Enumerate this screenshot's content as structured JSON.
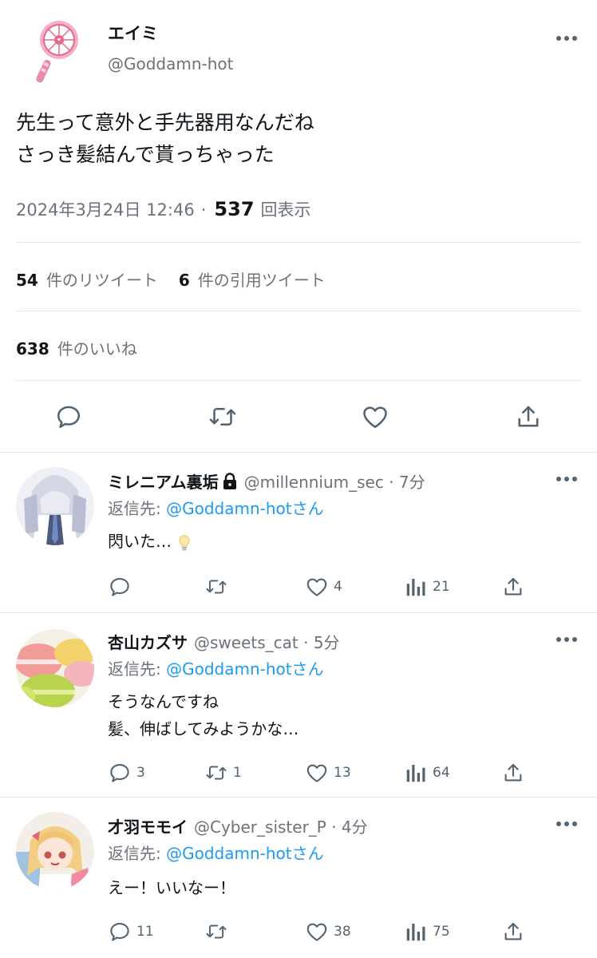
{
  "tweet": {
    "name": "エイミ",
    "handle": "@Goddamn-hot",
    "lines": [
      "先生って意外と手先器用なんだね",
      "さっき髪結んで貰っちゃった"
    ],
    "datetime": "2024年3月24日 12:46",
    "separator": "·",
    "views": "537",
    "views_label": "回表示",
    "retweets": "54",
    "retweets_label": "件のリツイート",
    "quotes": "6",
    "quotes_label": "件の引用ツイート",
    "likes": "638",
    "likes_label": "件のいいね"
  },
  "actions": {
    "icons": [
      "reply-icon",
      "retweet-icon",
      "like-icon",
      "share-icon"
    ]
  },
  "replies": [
    {
      "name": "ミレニアム裏垢",
      "locked": true,
      "handle": "@millennium_sec · 7分",
      "to_label": "返信先: ",
      "to_handle": "@Goddamn-hotさん",
      "lines": [
        "閃いた…"
      ],
      "reply_count": "",
      "retweet_count": "",
      "like_count": "4",
      "view_count": "21"
    },
    {
      "name": "杏山カズサ",
      "locked": false,
      "handle": "@sweets_cat · 5分",
      "to_label": "返信先: ",
      "to_handle": "@Goddamn-hotさん",
      "lines": [
        "そうなんですね",
        "髪、伸ばしてみようかな…"
      ],
      "reply_count": "3",
      "retweet_count": "1",
      "like_count": "13",
      "view_count": "64"
    },
    {
      "name": "才羽モモイ",
      "locked": false,
      "handle": "@Cyber_sister_P · 4分",
      "to_label": "返信先: ",
      "to_handle": "@Goddamn-hotさん",
      "lines": [
        "えー！いいなー！"
      ],
      "reply_count": "11",
      "retweet_count": "",
      "like_count": "38",
      "view_count": "75"
    }
  ],
  "colors": {
    "link": "#1d9bf0",
    "muted": "#6b7279",
    "icon": "#536471",
    "divider": "#e3e6e8"
  }
}
